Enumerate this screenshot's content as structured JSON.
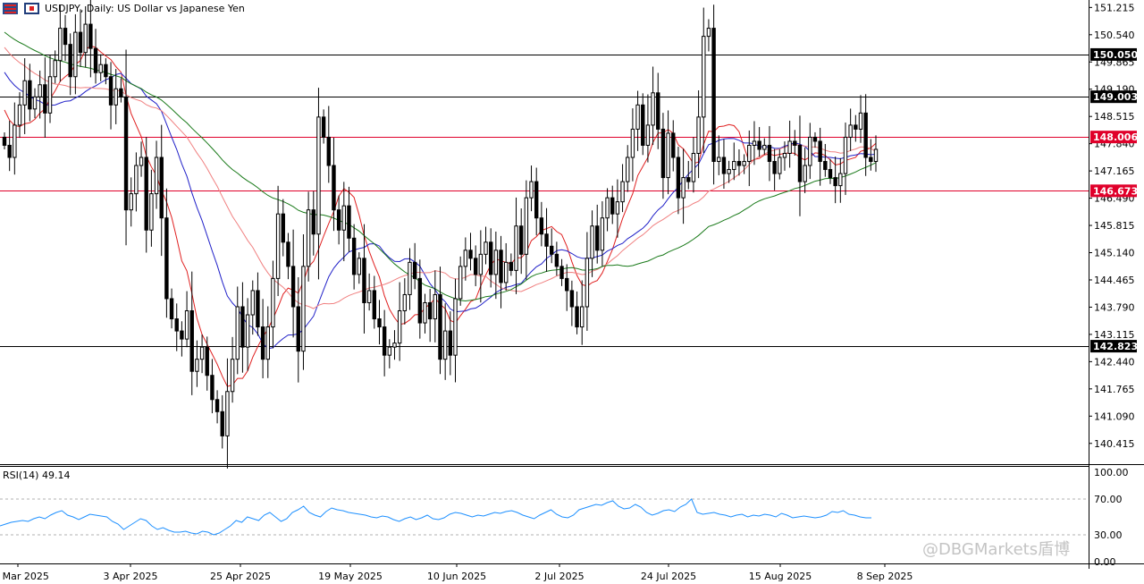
{
  "header": {
    "symbol": "USDJPY",
    "timeframe": "Daily",
    "description": "US Dollar vs Japanese Yen",
    "title_text": "USDJPY, Daily:  US Dollar vs Japanese Yen"
  },
  "watermark": "@DBGMarkets盾博",
  "rsi": {
    "label": "RSI(14) 49.14",
    "levels": [
      70,
      30
    ],
    "axis_labels": [
      "100.00",
      "70.00",
      "30.00",
      "0.00"
    ],
    "color": "#1e90ff",
    "values": [
      40,
      42,
      44,
      45,
      46,
      45,
      48,
      50,
      48,
      52,
      55,
      57,
      52,
      50,
      47,
      50,
      53,
      52,
      51,
      50,
      45,
      42,
      36,
      40,
      44,
      48,
      46,
      40,
      36,
      38,
      35,
      33,
      33,
      34,
      32,
      31,
      34,
      33,
      30,
      32,
      36,
      40,
      46,
      44,
      50,
      48,
      46,
      52,
      55,
      50,
      45,
      48,
      55,
      58,
      62,
      55,
      52,
      50,
      56,
      60,
      58,
      57,
      55,
      54,
      53,
      52,
      50,
      49,
      51,
      50,
      47,
      45,
      48,
      50,
      47,
      49,
      52,
      48,
      47,
      49,
      53,
      55,
      54,
      52,
      50,
      52,
      51,
      53,
      55,
      54,
      56,
      57,
      55,
      52,
      50,
      48,
      52,
      55,
      58,
      53,
      50,
      49,
      52,
      58,
      60,
      62,
      64,
      63,
      66,
      68,
      62,
      59,
      60,
      64,
      61,
      55,
      52,
      54,
      57,
      58,
      56,
      61,
      64,
      70,
      55,
      53,
      54,
      55,
      53,
      52,
      50,
      52,
      53,
      50,
      52,
      51,
      53,
      52,
      50,
      54,
      52,
      49,
      50,
      51,
      50,
      49,
      50,
      52,
      56,
      55,
      57,
      53,
      52,
      50,
      49,
      49
    ],
    "values_unit": "RSI (0-100)"
  },
  "x_labels": [
    "12 Mar 2025",
    "3 Apr 2025",
    "25 Apr 2025",
    "19 May 2025",
    "10 Jun 2025",
    "2 Jul 2025",
    "24 Jul 2025",
    "15 Aug 2025",
    "8 Sep 2025"
  ],
  "chart_data": {
    "type": "candlestick",
    "symbol": "USDJPY",
    "timeframe": "Daily",
    "title": "USDJPY, Daily:  US Dollar vs Japanese Yen",
    "ylim": [
      139.9,
      151.4
    ],
    "y_ticks": [
      "151.215",
      "150.540",
      "149.865",
      "149.190",
      "148.515",
      "147.840",
      "147.165",
      "146.490",
      "145.815",
      "145.140",
      "144.465",
      "143.790",
      "143.115",
      "142.440",
      "141.765",
      "141.090",
      "140.415"
    ],
    "x_labels": [
      "12 Mar 2025",
      "3 Apr 2025",
      "25 Apr 2025",
      "19 May 2025",
      "10 Jun 2025",
      "2 Jul 2025",
      "24 Jul 2025",
      "15 Aug 2025",
      "8 Sep 2025"
    ],
    "price_levels": [
      {
        "label": "150.050",
        "value": 150.05,
        "color": "#000000"
      },
      {
        "label": "149.003",
        "value": 149.003,
        "color": "#000000"
      },
      {
        "label": "148.006",
        "value": 148.006,
        "color": "#e0002a"
      },
      {
        "label": "146.673",
        "value": 146.673,
        "color": "#e0002a"
      },
      {
        "label": "142.823",
        "value": 142.823,
        "color": "#000000"
      }
    ],
    "moving_averages": [
      {
        "color": "#e02020"
      },
      {
        "color": "#2020c8"
      },
      {
        "color": "#f08080"
      },
      {
        "color": "#1a7a1a"
      }
    ],
    "close": [
      147.8,
      147.5,
      148.3,
      148.8,
      149.4,
      148.7,
      149.0,
      149.3,
      148.6,
      149.5,
      149.9,
      150.7,
      150.3,
      149.5,
      150.6,
      150.1,
      150.8,
      150.2,
      149.6,
      149.8,
      149.5,
      148.8,
      149.2,
      149.0,
      146.2,
      146.6,
      147.3,
      147.5,
      145.7,
      146.6,
      147.5,
      146.0,
      144.0,
      143.5,
      143.2,
      143.0,
      143.7,
      142.2,
      142.5,
      142.8,
      142.1,
      141.5,
      141.2,
      140.6,
      141.7,
      142.5,
      143.8,
      142.8,
      143.6,
      144.2,
      143.3,
      142.5,
      143.3,
      144.5,
      146.1,
      145.4,
      144.8,
      143.8,
      142.7,
      144.8,
      146.2,
      145.6,
      148.5,
      148.0,
      147.3,
      146.2,
      145.7,
      146.3,
      145.5,
      144.6,
      145.0,
      143.9,
      144.2,
      143.5,
      143.3,
      142.6,
      142.8,
      142.9,
      143.7,
      144.1,
      144.9,
      144.5,
      143.4,
      143.9,
      143.5,
      144.1,
      142.5,
      143.2,
      142.6,
      144.0,
      144.8,
      145.2,
      145.0,
      144.6,
      145.1,
      145.4,
      144.6,
      145.2,
      144.4,
      144.9,
      144.7,
      145.8,
      145.1,
      146.5,
      146.9,
      146.0,
      145.6,
      145.3,
      145.1,
      144.8,
      144.5,
      144.2,
      143.8,
      143.3,
      143.8,
      145.0,
      145.8,
      145.2,
      146.0,
      146.5,
      146.1,
      146.4,
      146.9,
      147.5,
      148.2,
      148.8,
      147.8,
      148.3,
      149.1,
      148.2,
      147.0,
      148.1,
      147.5,
      146.5,
      147.0,
      146.9,
      147.6,
      148.5,
      150.5,
      150.7,
      147.4,
      147.5,
      147.1,
      147.2,
      147.4,
      147.3,
      147.4,
      147.8,
      147.9,
      147.7,
      147.8,
      147.4,
      147.1,
      147.5,
      147.6,
      147.9,
      147.8,
      146.9,
      147.3,
      148.0,
      147.9,
      147.4,
      147.2,
      147.0,
      146.8,
      147.1,
      148.0,
      148.3,
      148.2,
      148.6,
      147.5,
      147.4,
      147.7
    ],
    "ohlc_note": "values approximated from the rendered candles"
  }
}
